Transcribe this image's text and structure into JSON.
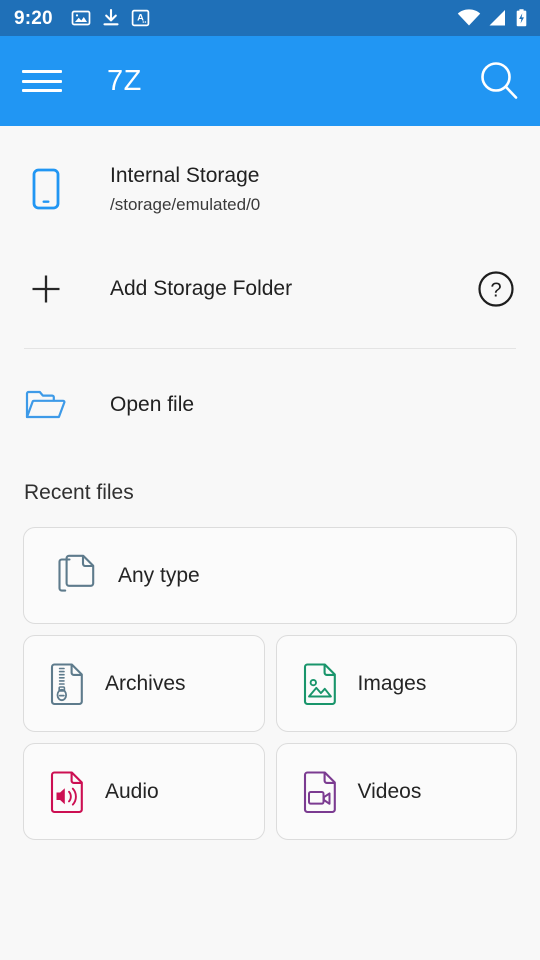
{
  "status_bar": {
    "clock": "9:20",
    "background": "#1f70b8",
    "left_icons": [
      "gallery-icon",
      "download-icon",
      "text-a-icon"
    ],
    "right_icons": [
      "wifi-icon",
      "cellular-signal-icon",
      "battery-charging-icon"
    ]
  },
  "app_bar": {
    "title": "7Z",
    "background": "#2196f3",
    "menu_icon": "hamburger-menu-icon",
    "search_icon": "search-icon"
  },
  "storage": {
    "title": "Internal Storage",
    "path": "/storage/emulated/0",
    "icon": "phone-storage-icon",
    "icon_color": "#2196f3"
  },
  "add_storage": {
    "label": "Add Storage Folder",
    "icon": "plus-icon",
    "help_icon": "help-circle-icon"
  },
  "open_file": {
    "label": "Open file",
    "icon": "open-folder-icon",
    "icon_color": "#3d9ae8"
  },
  "recent": {
    "section_title": "Recent files",
    "cards": [
      {
        "label": "Any type",
        "icon": "documents-copy-icon",
        "color": "#5e7b8c",
        "span": "full"
      },
      {
        "label": "Archives",
        "icon": "archive-zip-file-icon",
        "color": "#5e7b8c",
        "span": "half"
      },
      {
        "label": "Images",
        "icon": "image-file-icon",
        "color": "#19956b",
        "span": "half"
      },
      {
        "label": "Audio",
        "icon": "audio-file-icon",
        "color": "#cc0f52",
        "span": "half"
      },
      {
        "label": "Videos",
        "icon": "video-file-icon",
        "color": "#7b3b91",
        "span": "half"
      }
    ]
  }
}
